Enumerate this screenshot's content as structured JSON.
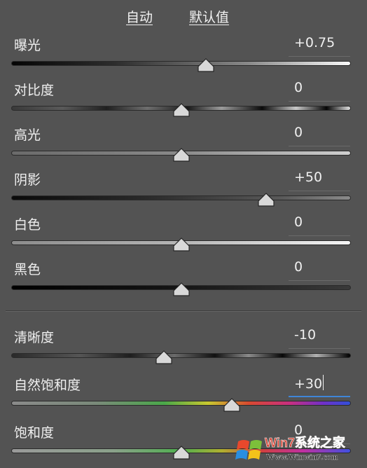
{
  "header": {
    "auto_label": "自动",
    "default_label": "默认值"
  },
  "sliders": [
    {
      "id": "exposure",
      "label": "曝光",
      "value": "+0.75",
      "fraction": 0.573
    },
    {
      "id": "contrast",
      "label": "对比度",
      "value": "0",
      "fraction": 0.5
    },
    {
      "id": "highlights",
      "label": "高光",
      "value": "0",
      "fraction": 0.5
    },
    {
      "id": "shadows",
      "label": "阴影",
      "value": "+50",
      "fraction": 0.75
    },
    {
      "id": "whites",
      "label": "白色",
      "value": "0",
      "fraction": 0.5
    },
    {
      "id": "blacks",
      "label": "黑色",
      "value": "0",
      "fraction": 0.5
    },
    {
      "id": "clarity",
      "label": "清晰度",
      "value": "-10",
      "fraction": 0.45,
      "focused": false
    },
    {
      "id": "vibrance",
      "label": "自然饱和度",
      "value": "+30",
      "fraction": 0.65,
      "focused": true
    },
    {
      "id": "saturation",
      "label": "饱和度",
      "value": "0",
      "fraction": 0.5
    }
  ],
  "watermark": {
    "brand_text": "Win7系统之家",
    "url_text": "Www.Winwin7.com"
  },
  "colors": {
    "background": "#535353",
    "focus_underline": "#3f86d8",
    "thumb_fill": "#d8d8d8"
  }
}
